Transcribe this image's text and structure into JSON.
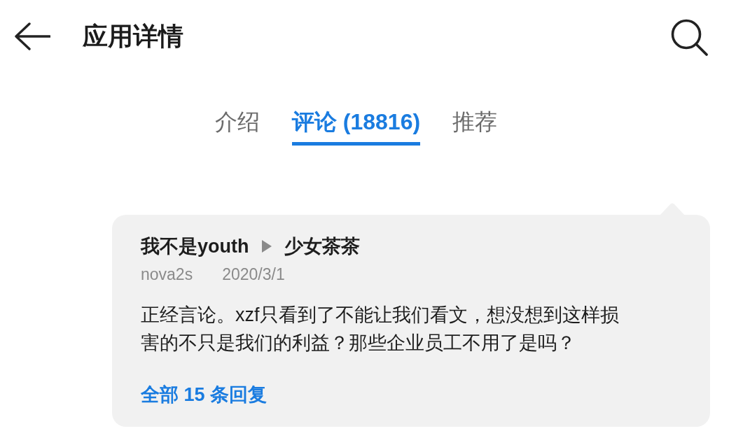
{
  "header": {
    "title": "应用详情"
  },
  "tabs": [
    {
      "label": "介绍",
      "selected": false
    },
    {
      "label": "评论 (18816)",
      "selected": true
    },
    {
      "label": "推荐",
      "selected": false
    }
  ],
  "comment": {
    "author": "我不是youth",
    "reply_to": "少女茶茶",
    "device": "nova2s",
    "date": "2020/3/1",
    "text": "正经言论。xzf只看到了不能让我们看文，想没想到这样损害的不只是我们的利益？那些企业员工不用了是吗？",
    "replies_link": "全部 15 条回复"
  }
}
